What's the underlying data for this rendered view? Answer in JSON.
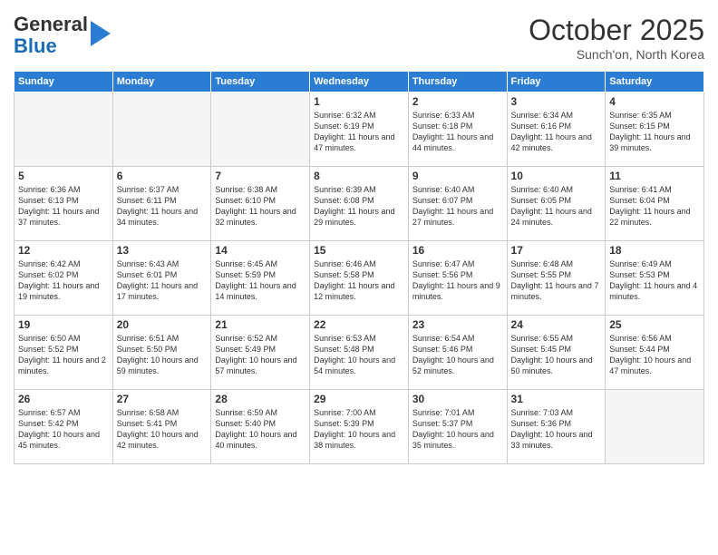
{
  "header": {
    "logo_general": "General",
    "logo_blue": "Blue",
    "month_title": "October 2025",
    "subtitle": "Sunch'on, North Korea"
  },
  "days_of_week": [
    "Sunday",
    "Monday",
    "Tuesday",
    "Wednesday",
    "Thursday",
    "Friday",
    "Saturday"
  ],
  "weeks": [
    [
      {
        "day": "",
        "empty": true
      },
      {
        "day": "",
        "empty": true
      },
      {
        "day": "",
        "empty": true
      },
      {
        "day": "1",
        "sunrise": "6:32 AM",
        "sunset": "6:19 PM",
        "daylight": "11 hours and 47 minutes."
      },
      {
        "day": "2",
        "sunrise": "6:33 AM",
        "sunset": "6:18 PM",
        "daylight": "11 hours and 44 minutes."
      },
      {
        "day": "3",
        "sunrise": "6:34 AM",
        "sunset": "6:16 PM",
        "daylight": "11 hours and 42 minutes."
      },
      {
        "day": "4",
        "sunrise": "6:35 AM",
        "sunset": "6:15 PM",
        "daylight": "11 hours and 39 minutes."
      }
    ],
    [
      {
        "day": "5",
        "sunrise": "6:36 AM",
        "sunset": "6:13 PM",
        "daylight": "11 hours and 37 minutes."
      },
      {
        "day": "6",
        "sunrise": "6:37 AM",
        "sunset": "6:11 PM",
        "daylight": "11 hours and 34 minutes."
      },
      {
        "day": "7",
        "sunrise": "6:38 AM",
        "sunset": "6:10 PM",
        "daylight": "11 hours and 32 minutes."
      },
      {
        "day": "8",
        "sunrise": "6:39 AM",
        "sunset": "6:08 PM",
        "daylight": "11 hours and 29 minutes."
      },
      {
        "day": "9",
        "sunrise": "6:40 AM",
        "sunset": "6:07 PM",
        "daylight": "11 hours and 27 minutes."
      },
      {
        "day": "10",
        "sunrise": "6:40 AM",
        "sunset": "6:05 PM",
        "daylight": "11 hours and 24 minutes."
      },
      {
        "day": "11",
        "sunrise": "6:41 AM",
        "sunset": "6:04 PM",
        "daylight": "11 hours and 22 minutes."
      }
    ],
    [
      {
        "day": "12",
        "sunrise": "6:42 AM",
        "sunset": "6:02 PM",
        "daylight": "11 hours and 19 minutes."
      },
      {
        "day": "13",
        "sunrise": "6:43 AM",
        "sunset": "6:01 PM",
        "daylight": "11 hours and 17 minutes."
      },
      {
        "day": "14",
        "sunrise": "6:45 AM",
        "sunset": "5:59 PM",
        "daylight": "11 hours and 14 minutes."
      },
      {
        "day": "15",
        "sunrise": "6:46 AM",
        "sunset": "5:58 PM",
        "daylight": "11 hours and 12 minutes."
      },
      {
        "day": "16",
        "sunrise": "6:47 AM",
        "sunset": "5:56 PM",
        "daylight": "11 hours and 9 minutes."
      },
      {
        "day": "17",
        "sunrise": "6:48 AM",
        "sunset": "5:55 PM",
        "daylight": "11 hours and 7 minutes."
      },
      {
        "day": "18",
        "sunrise": "6:49 AM",
        "sunset": "5:53 PM",
        "daylight": "11 hours and 4 minutes."
      }
    ],
    [
      {
        "day": "19",
        "sunrise": "6:50 AM",
        "sunset": "5:52 PM",
        "daylight": "11 hours and 2 minutes."
      },
      {
        "day": "20",
        "sunrise": "6:51 AM",
        "sunset": "5:50 PM",
        "daylight": "10 hours and 59 minutes."
      },
      {
        "day": "21",
        "sunrise": "6:52 AM",
        "sunset": "5:49 PM",
        "daylight": "10 hours and 57 minutes."
      },
      {
        "day": "22",
        "sunrise": "6:53 AM",
        "sunset": "5:48 PM",
        "daylight": "10 hours and 54 minutes."
      },
      {
        "day": "23",
        "sunrise": "6:54 AM",
        "sunset": "5:46 PM",
        "daylight": "10 hours and 52 minutes."
      },
      {
        "day": "24",
        "sunrise": "6:55 AM",
        "sunset": "5:45 PM",
        "daylight": "10 hours and 50 minutes."
      },
      {
        "day": "25",
        "sunrise": "6:56 AM",
        "sunset": "5:44 PM",
        "daylight": "10 hours and 47 minutes."
      }
    ],
    [
      {
        "day": "26",
        "sunrise": "6:57 AM",
        "sunset": "5:42 PM",
        "daylight": "10 hours and 45 minutes."
      },
      {
        "day": "27",
        "sunrise": "6:58 AM",
        "sunset": "5:41 PM",
        "daylight": "10 hours and 42 minutes."
      },
      {
        "day": "28",
        "sunrise": "6:59 AM",
        "sunset": "5:40 PM",
        "daylight": "10 hours and 40 minutes."
      },
      {
        "day": "29",
        "sunrise": "7:00 AM",
        "sunset": "5:39 PM",
        "daylight": "10 hours and 38 minutes."
      },
      {
        "day": "30",
        "sunrise": "7:01 AM",
        "sunset": "5:37 PM",
        "daylight": "10 hours and 35 minutes."
      },
      {
        "day": "31",
        "sunrise": "7:03 AM",
        "sunset": "5:36 PM",
        "daylight": "10 hours and 33 minutes."
      },
      {
        "day": "",
        "empty": true
      }
    ]
  ],
  "labels": {
    "sunrise_prefix": "Sunrise:",
    "sunset_prefix": "Sunset:",
    "daylight_prefix": "Daylight:"
  }
}
